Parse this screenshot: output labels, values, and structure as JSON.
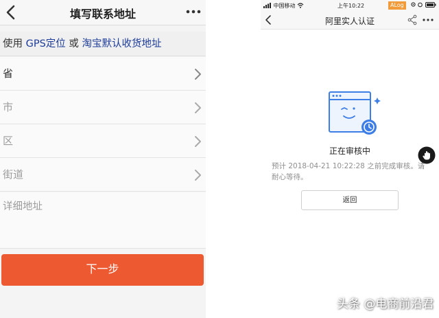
{
  "left": {
    "nav_title": "填写联系地址",
    "locate": {
      "prefix": "使用 ",
      "gps_link": "GPS定位",
      "or": " 或 ",
      "taobao_link": "淘宝默认收货地址"
    },
    "rows": [
      "省",
      "市",
      "区",
      "街道"
    ],
    "detail_placeholder": "详细地址",
    "next_button": "下一步",
    "accent_color": "#ed5a32",
    "link_color": "#1d3c99"
  },
  "right": {
    "status": {
      "carrier": "中国移动",
      "time": "上午10:22",
      "alog": "ALog"
    },
    "nav_title": "阿里实人认证",
    "review_title": "正在审核中",
    "review_desc": "预计 2018-04-21 10:22:28 之前完成审核。请耐心等待。",
    "back_button": "返回",
    "illustration_color": "#3d7de6"
  },
  "watermark": "头条 @电商前沿君"
}
